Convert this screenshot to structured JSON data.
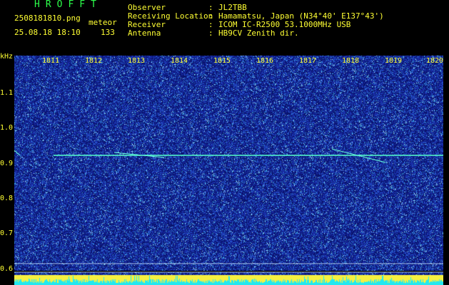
{
  "header": {
    "app_title": "HROFFT",
    "filename": "2508181810.png",
    "datetime": "25.08.18 18:10",
    "mode_label": "meteor",
    "count": "133"
  },
  "station": [
    {
      "key": "Observer",
      "sep": ":",
      "value": "JL2TBB"
    },
    {
      "key": "Receiving Location",
      "sep": ":",
      "value": "Hamamatsu, Japan (N34°40' E137°43')"
    },
    {
      "key": "Receiver",
      "sep": ":",
      "value": "ICOM IC-R2500 53.1000MHz USB"
    },
    {
      "key": "Antenna",
      "sep": ":",
      "value": "HB9CV Zenith dir."
    }
  ],
  "axes": {
    "y_unit": "kHz",
    "y_ticks": [
      "1.1",
      "1.0",
      "0.9",
      "0.8",
      "0.7",
      "0.6"
    ],
    "x_ticks": [
      "1811",
      "1812",
      "1813",
      "1814",
      "1815",
      "1816",
      "1817",
      "1818",
      "1819",
      "1820"
    ]
  },
  "colors": {
    "header_green": "#2cff4a",
    "label_yellow": "#ffff33",
    "background": "#000000",
    "noise_blue": "#1a2a9a",
    "signal_cyan": "#33ffcc"
  }
}
